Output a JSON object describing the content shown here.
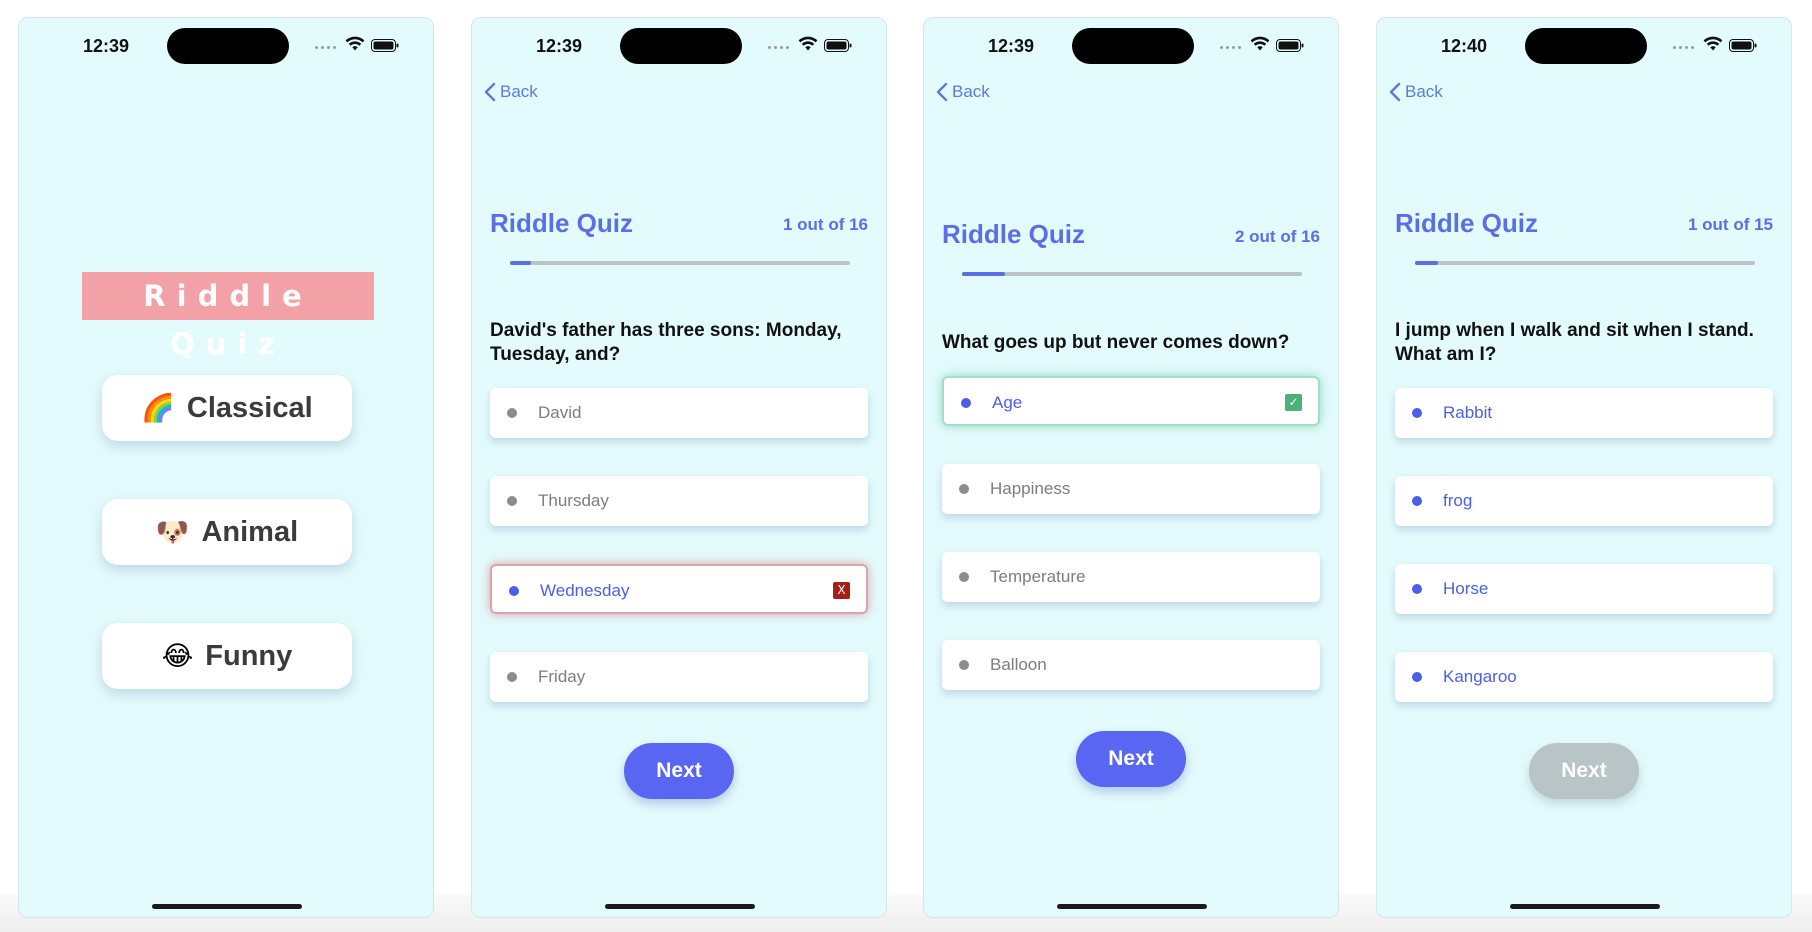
{
  "home": {
    "status_time": "12:39",
    "logo": "Riddle Quiz",
    "categories": [
      {
        "emoji": "🌈",
        "label": "Classical"
      },
      {
        "emoji": "🐶",
        "label": "Animal"
      },
      {
        "emoji": "😂",
        "label": "Funny"
      }
    ]
  },
  "quiz1": {
    "status_time": "12:39",
    "back_label": "Back",
    "title": "Riddle Quiz",
    "count": "1 out of 16",
    "progress": 0.0625,
    "question": "David's father has three sons: Monday, Tuesday, and?",
    "options": [
      "David",
      "Thursday",
      "Wednesday",
      "Friday"
    ],
    "selected_option": "Wednesday",
    "selected_mark": "X",
    "next_label": "Next"
  },
  "quiz2": {
    "status_time": "12:39",
    "back_label": "Back",
    "title": "Riddle Quiz",
    "count": "2 out of 16",
    "progress": 0.125,
    "question": "What goes up but never comes down?",
    "options": [
      "Age",
      "Happiness",
      "Temperature",
      "Balloon"
    ],
    "selected_option": "Age",
    "selected_mark": "✓",
    "next_label": "Next"
  },
  "quiz3": {
    "status_time": "12:40",
    "back_label": "Back",
    "title": "Riddle Quiz",
    "count": "1 out of 15",
    "progress": 0.0667,
    "question": "I jump when I walk and sit when I stand. What am I?",
    "options": [
      "Rabbit",
      "frog",
      "Horse",
      "Kangaroo"
    ],
    "next_label": "Next",
    "next_enabled": false
  },
  "colors": {
    "background": "#e3fbfc",
    "accent": "#5a6fe6",
    "button": "#5866f2",
    "button_disabled": "#b8c4c5",
    "logo_bg": "#f2a1a6",
    "wrong": "#a81d17",
    "correct": "#4bb079"
  }
}
